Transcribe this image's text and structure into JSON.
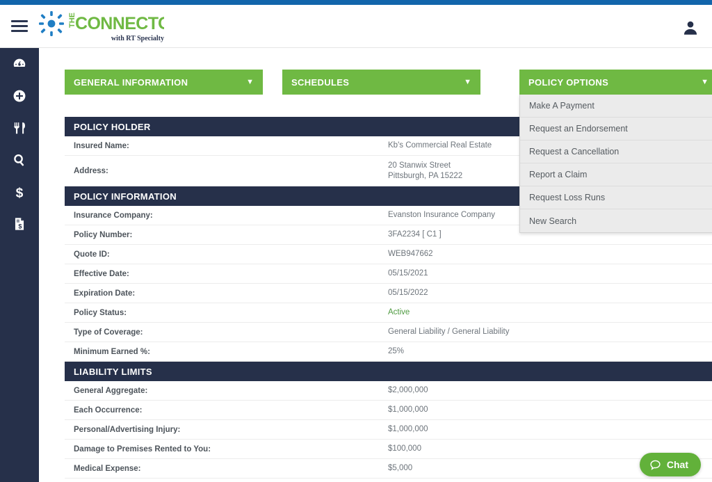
{
  "brand": {
    "logo_the": "THE",
    "logo_name": "CONNECTOR",
    "tagline": "with RT Specialty",
    "accent_green": "#6fb943",
    "accent_blue": "#1265ab",
    "navy": "#26304a"
  },
  "header": {
    "menu_icon": "hamburger-icon",
    "account_icon": "user-icon"
  },
  "sidebar": {
    "items": [
      {
        "name": "dashboard",
        "icon": "speedometer-icon"
      },
      {
        "name": "add",
        "icon": "plus-circle-icon"
      },
      {
        "name": "restaurant",
        "icon": "utensils-icon"
      },
      {
        "name": "search",
        "icon": "magnifier-icon"
      },
      {
        "name": "payments",
        "icon": "dollar-sign-icon"
      },
      {
        "name": "invoices",
        "icon": "invoice-document-icon"
      }
    ]
  },
  "accordions": [
    {
      "id": "general",
      "label": "GENERAL INFORMATION",
      "caret": "▼",
      "expanded": true
    },
    {
      "id": "schedules",
      "label": "SCHEDULES",
      "caret": "▼",
      "expanded": false
    },
    {
      "id": "options",
      "label": "POLICY OPTIONS",
      "caret": "▼",
      "expanded": true
    }
  ],
  "policy_options_menu": [
    "Make A Payment",
    "Request an Endorsement",
    "Request a Cancellation",
    "Report a Claim",
    "Request Loss Runs",
    "New Search"
  ],
  "sections": [
    {
      "title": "POLICY HOLDER",
      "rows": [
        {
          "label": "Insured Name:",
          "value": "Kb's Commercial Real Estate",
          "tall": false,
          "green": false
        },
        {
          "label": "Address:",
          "value": "20 Stanwix Street\nPittsburgh, PA 15222",
          "tall": true,
          "green": false
        }
      ]
    },
    {
      "title": "POLICY INFORMATION",
      "rows": [
        {
          "label": "Insurance Company:",
          "value": "Evanston Insurance Company",
          "tall": false,
          "green": false
        },
        {
          "label": "Policy Number:",
          "value": "3FA2234 [ C1 ]",
          "tall": false,
          "green": false
        },
        {
          "label": "Quote ID:",
          "value": "WEB947662",
          "tall": false,
          "green": false
        },
        {
          "label": "Effective Date:",
          "value": "05/15/2021",
          "tall": false,
          "green": false
        },
        {
          "label": "Expiration Date:",
          "value": "05/15/2022",
          "tall": false,
          "green": false
        },
        {
          "label": "Policy Status:",
          "value": "Active",
          "tall": false,
          "green": true
        },
        {
          "label": "Type of Coverage:",
          "value": "General Liability / General Liability",
          "tall": false,
          "green": false
        },
        {
          "label": "Minimum Earned %:",
          "value": "25%",
          "tall": false,
          "green": false
        }
      ]
    },
    {
      "title": "LIABILITY LIMITS",
      "rows": [
        {
          "label": "General Aggregate:",
          "value": "$2,000,000",
          "tall": false,
          "green": false
        },
        {
          "label": "Each Occurrence:",
          "value": "$1,000,000",
          "tall": false,
          "green": false
        },
        {
          "label": "Personal/Advertising Injury:",
          "value": "$1,000,000",
          "tall": false,
          "green": false
        },
        {
          "label": "Damage to Premises Rented to You:",
          "value": "$100,000",
          "tall": false,
          "green": false
        },
        {
          "label": "Medical Expense:",
          "value": "$5,000",
          "tall": false,
          "green": false
        }
      ]
    }
  ],
  "chat": {
    "label": "Chat",
    "icon": "speech-bubble-icon"
  }
}
